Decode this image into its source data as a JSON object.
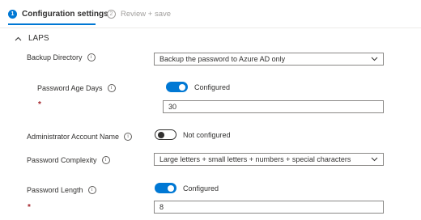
{
  "wizard": {
    "steps": [
      {
        "number": "1",
        "label": "Configuration settings"
      },
      {
        "number": "2",
        "label": "Review + save"
      }
    ]
  },
  "section": {
    "title": "LAPS"
  },
  "settings": {
    "backup_directory": {
      "label": "Backup Directory",
      "value": "Backup the password to Azure AD only"
    },
    "password_age_days": {
      "label": "Password Age Days",
      "toggle_state": "Configured",
      "required": "*",
      "value": "30"
    },
    "administrator_account_name": {
      "label": "Administrator Account Name",
      "toggle_state": "Not configured"
    },
    "password_complexity": {
      "label": "Password Complexity",
      "value": "Large letters + small letters + numbers + special characters"
    },
    "password_length": {
      "label": "Password Length",
      "toggle_state": "Configured",
      "required": "*",
      "value": "8"
    }
  },
  "colors": {
    "accent": "#0078d4",
    "required": "#a4262c",
    "inactive": "#a19f9d"
  }
}
